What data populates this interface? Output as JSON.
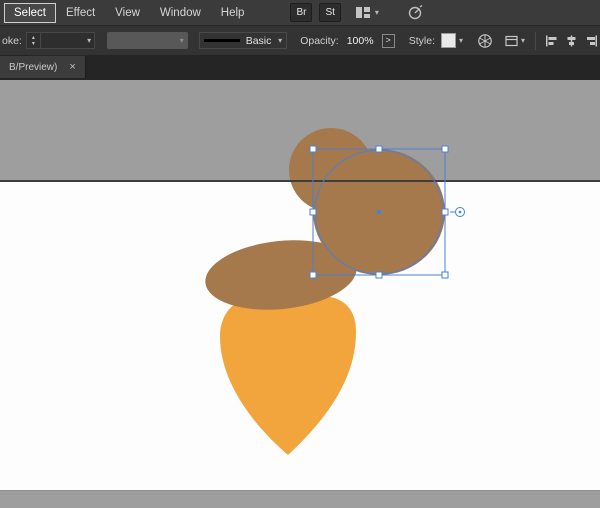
{
  "menubar": {
    "items": [
      {
        "label": "Select",
        "active": true
      },
      {
        "label": "Effect",
        "active": false
      },
      {
        "label": "View",
        "active": false
      },
      {
        "label": "Window",
        "active": false
      },
      {
        "label": "Help",
        "active": false
      }
    ],
    "br_button_label": "Br",
    "st_button_label": "St"
  },
  "controlbar": {
    "stroke_label_partial": "oke:",
    "brush_style_name": "Basic",
    "opacity_label": "Opacity:",
    "opacity_value": "100%",
    "opacity_expand": ">",
    "style_label": "Style:"
  },
  "tabbar": {
    "document_tab_partial": "B/Preview)",
    "close_glyph": "×"
  },
  "icons": {
    "chevron_down": "▾",
    "stepper_up": "▴",
    "stepper_down": "▾"
  },
  "colors": {
    "pasteboard": "#9E9E9E",
    "artboard": "#FDFDFD",
    "artboard_edge": "#3E3E3E",
    "artboard_edge_bottom": "#8F8F8F",
    "acorn_brown": "#A5794B",
    "acorn_orange": "#F3A53D",
    "selection_blue": "#4C7FD6",
    "handle_fill": "#FFFFFF"
  }
}
